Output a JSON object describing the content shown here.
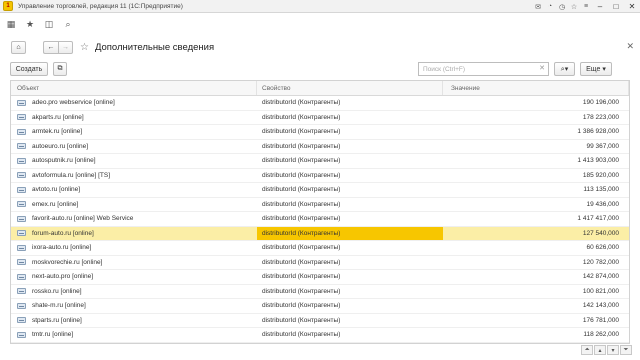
{
  "window": {
    "title": "Управление торговлей, редакция 11 (1С:Предприятие)"
  },
  "header": {
    "page_title": "Дополнительные сведения"
  },
  "toolbar": {
    "create_label": "Создать",
    "search_placeholder": "Поиск (Ctrl+F)",
    "more_label": "Еще ▾"
  },
  "table": {
    "columns": [
      "Объект",
      "Свойство",
      "Значение"
    ],
    "rows": [
      {
        "object": "adeo.pro webservice [online]",
        "property": "distributorId (Контрагенты)",
        "value": "190 196,000"
      },
      {
        "object": "akparts.ru [online]",
        "property": "distributorId (Контрагенты)",
        "value": "178 223,000"
      },
      {
        "object": "armtek.ru [online]",
        "property": "distributorId (Контрагенты)",
        "value": "1 386 928,000"
      },
      {
        "object": "autoeuro.ru [online]",
        "property": "distributorId (Контрагенты)",
        "value": "99 367,000"
      },
      {
        "object": "autosputnik.ru [online]",
        "property": "distributorId (Контрагенты)",
        "value": "1 413 903,000"
      },
      {
        "object": "avtoformula.ru [online] [TS]",
        "property": "distributorId (Контрагенты)",
        "value": "185 920,000"
      },
      {
        "object": "avtoto.ru [online]",
        "property": "distributorId (Контрагенты)",
        "value": "113 135,000"
      },
      {
        "object": "emex.ru [online]",
        "property": "distributorId (Контрагенты)",
        "value": "19 436,000"
      },
      {
        "object": "favorit-auto.ru [online] Web Service",
        "property": "distributorId (Контрагенты)",
        "value": "1 417 417,000"
      },
      {
        "object": "forum-auto.ru [online]",
        "property": "distributorId (Контрагенты)",
        "value": "127 540,000"
      },
      {
        "object": "ixora-auto.ru [online]",
        "property": "distributorId (Контрагенты)",
        "value": "60 626,000"
      },
      {
        "object": "moskvorechie.ru [online]",
        "property": "distributorId (Контрагенты)",
        "value": "120 782,000"
      },
      {
        "object": "next-auto.pro [online]",
        "property": "distributorId (Контрагенты)",
        "value": "142 874,000"
      },
      {
        "object": "rossko.ru [online]",
        "property": "distributorId (Контрагенты)",
        "value": "100 821,000"
      },
      {
        "object": "shate-m.ru [online]",
        "property": "distributorId (Контрагенты)",
        "value": "142 143,000"
      },
      {
        "object": "stparts.ru [online]",
        "property": "distributorId (Контрагенты)",
        "value": "176 781,000"
      },
      {
        "object": "tmtr.ru [online]",
        "property": "distributorId (Контрагенты)",
        "value": "118 262,000"
      }
    ],
    "selected_row": 9
  },
  "colors": {
    "selection_row": "#fbeea6",
    "selection_cell": "#f7c600"
  },
  "icons": [
    "app-logo-icon",
    "home-icon",
    "star-icon",
    "history-icon",
    "search-icon",
    "back-arrow-icon",
    "forward-arrow-icon",
    "favorite-star-icon",
    "close-icon",
    "copy-icon",
    "search-dropdown-icon",
    "row-object-icon"
  ]
}
